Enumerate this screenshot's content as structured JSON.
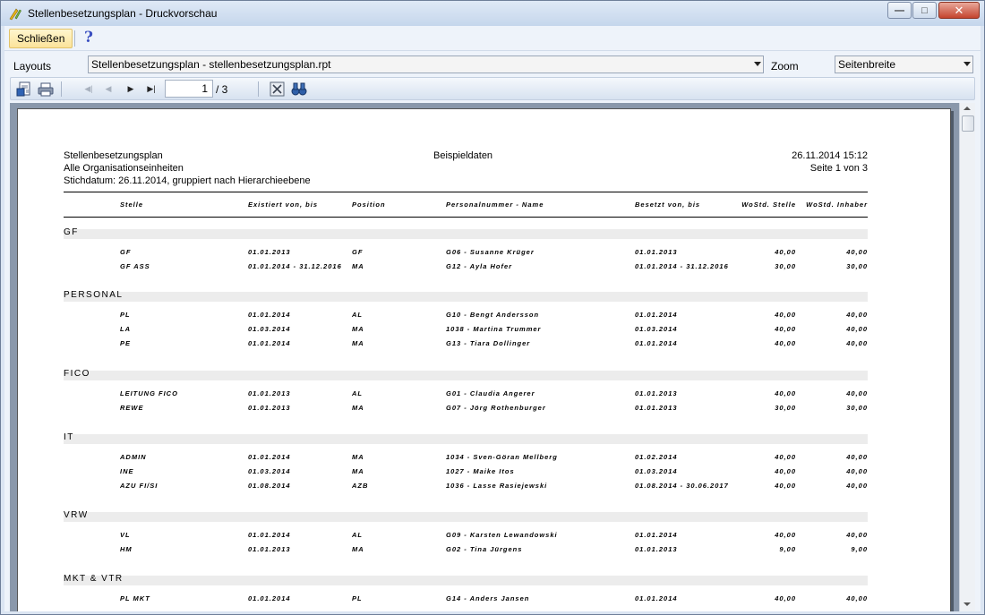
{
  "window": {
    "title": "Stellenbesetzungsplan - Druckvorschau"
  },
  "menubar": {
    "close_label": "Schließen",
    "help_icon": "?"
  },
  "layouts_row": {
    "layouts_label": "Layouts",
    "layout_value": "Stellenbesetzungsplan - stellenbesetzungsplan.rpt",
    "zoom_label": "Zoom",
    "zoom_value": "Seitenbreite"
  },
  "navbar": {
    "current_page": "1",
    "total_pages": "/ 3"
  },
  "report": {
    "header": {
      "title": "Stellenbesetzungsplan",
      "subtitle": "Alle Organisationseinheiten",
      "stichdatum": "Stichdatum: 26.11.2014, gruppiert nach Hierarchieebene",
      "center": "Beispieldaten",
      "datetime": "26.11.2014 15:12",
      "page": "Seite 1 von 3"
    },
    "columns": [
      "Stelle",
      "Existiert von, bis",
      "Position",
      "Personalnummer - Name",
      "Besetzt von, bis",
      "WoStd. Stelle",
      "WoStd. Inhaber"
    ],
    "groups": [
      {
        "name": "GF",
        "rows": [
          [
            "GF",
            "01.01.2013",
            "GF",
            "G06 - Susanne Krüger",
            "01.01.2013",
            "40,00",
            "40,00"
          ],
          [
            "GF ASS",
            "01.01.2014 - 31.12.2016",
            "MA",
            "G12 - Ayla Hofer",
            "01.01.2014 - 31.12.2016",
            "30,00",
            "30,00"
          ]
        ]
      },
      {
        "name": "PERSONAL",
        "rows": [
          [
            "PL",
            "01.01.2014",
            "AL",
            "G10 - Bengt Andersson",
            "01.01.2014",
            "40,00",
            "40,00"
          ],
          [
            "LA",
            "01.03.2014",
            "MA",
            "1038 - Martina Trummer",
            "01.03.2014",
            "40,00",
            "40,00"
          ],
          [
            "PE",
            "01.01.2014",
            "MA",
            "G13 - Tiara Dollinger",
            "01.01.2014",
            "40,00",
            "40,00"
          ]
        ]
      },
      {
        "name": "FICO",
        "rows": [
          [
            "LEITUNG FICO",
            "01.01.2013",
            "AL",
            "G01 - Claudia Angerer",
            "01.01.2013",
            "40,00",
            "40,00"
          ],
          [
            "REWE",
            "01.01.2013",
            "MA",
            "G07 - Jörg Rothenburger",
            "01.01.2013",
            "30,00",
            "30,00"
          ]
        ]
      },
      {
        "name": "IT",
        "rows": [
          [
            "ADMIN",
            "01.01.2014",
            "MA",
            "1034 - Sven-Göran Mellberg",
            "01.02.2014",
            "40,00",
            "40,00"
          ],
          [
            "INE",
            "01.03.2014",
            "MA",
            "1027 - Maike Itos",
            "01.03.2014",
            "40,00",
            "40,00"
          ],
          [
            "AZU FI/SI",
            "01.08.2014",
            "AZB",
            "1036 - Lasse Rasiejewski",
            "01.08.2014 - 30.06.2017",
            "40,00",
            "40,00"
          ]
        ]
      },
      {
        "name": "VRW",
        "rows": [
          [
            "VL",
            "01.01.2014",
            "AL",
            "G09 - Karsten Lewandowski",
            "01.01.2014",
            "40,00",
            "40,00"
          ],
          [
            "HM",
            "01.01.2013",
            "MA",
            "G02 - Tina Jürgens",
            "01.01.2013",
            "9,00",
            "9,00"
          ]
        ]
      },
      {
        "name": "MKT & VTR",
        "rows": [
          [
            "PL MKT",
            "01.01.2014",
            "PL",
            "G14 - Anders Jansen",
            "01.01.2014",
            "40,00",
            "40,00"
          ]
        ]
      }
    ]
  }
}
